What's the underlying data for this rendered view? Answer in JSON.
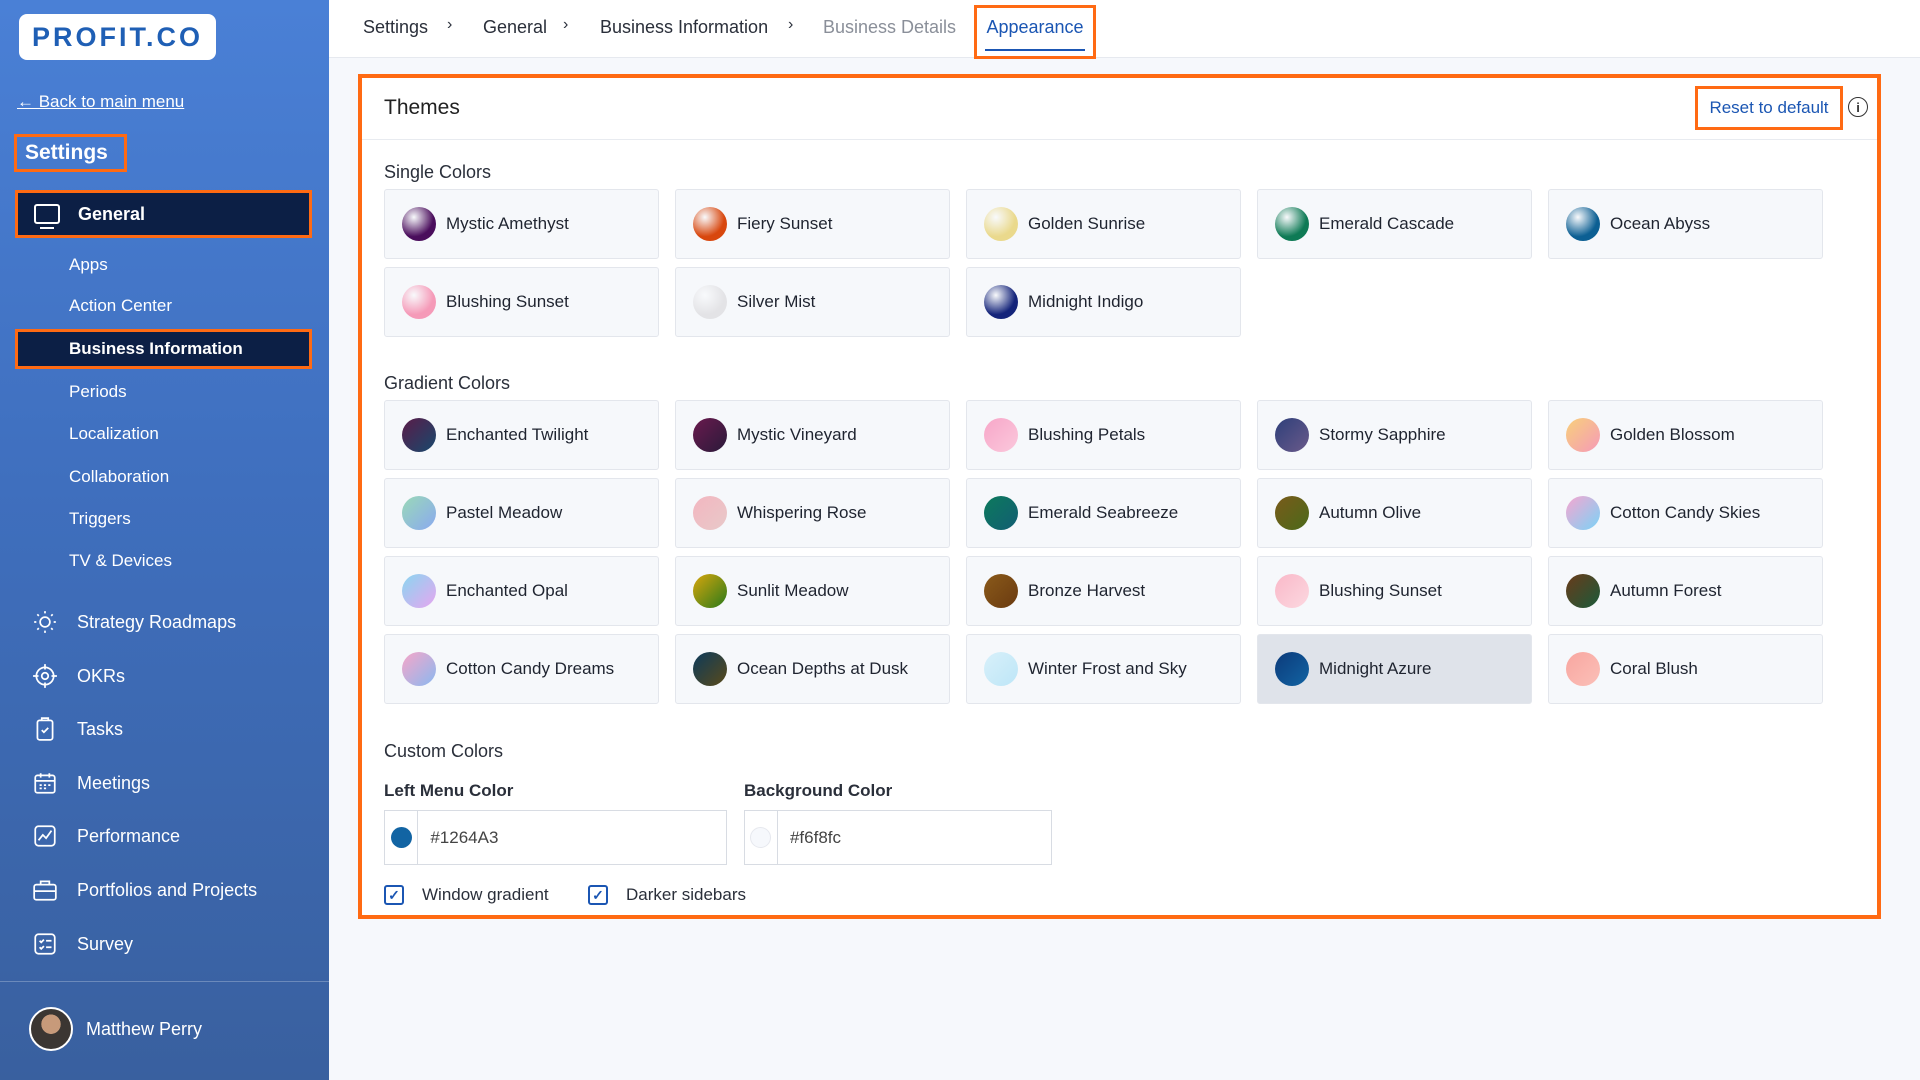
{
  "sidebar": {
    "logo": "PROFIT.CO",
    "back_link": "← Back to main menu",
    "title": "Settings",
    "general": {
      "label": "General",
      "icon": "monitor-icon"
    },
    "sub_items": [
      "Apps",
      "Action Center",
      "Business Information",
      "Periods",
      "Localization",
      "Collaboration",
      "Triggers",
      "TV & Devices"
    ],
    "active_sub_item": "Business Information",
    "main_items": [
      {
        "label": "Strategy Roadmaps",
        "icon": "lightbulb-icon"
      },
      {
        "label": "OKRs",
        "icon": "target-icon"
      },
      {
        "label": "Tasks",
        "icon": "clipboard-check-icon"
      },
      {
        "label": "Meetings",
        "icon": "calendar-icon"
      },
      {
        "label": "Performance",
        "icon": "chart-line-icon"
      },
      {
        "label": "Portfolios and Projects",
        "icon": "briefcase-icon"
      },
      {
        "label": "Survey",
        "icon": "list-check-icon"
      }
    ],
    "user": {
      "name": "Matthew Perry"
    }
  },
  "breadcrumb": {
    "items": [
      "Settings",
      "General",
      "Business Information"
    ],
    "muted": "Business Details",
    "active": "Appearance",
    "separator": "›"
  },
  "panel": {
    "title": "Themes",
    "reset_label": "Reset to default",
    "info_icon": "info-icon",
    "single_label": "Single Colors",
    "single_colors": [
      {
        "name": "Mystic Amethyst",
        "color": "#4a0d5c"
      },
      {
        "name": "Fiery Sunset",
        "color": "#d8470e"
      },
      {
        "name": "Golden Sunrise",
        "color": "#ead98c"
      },
      {
        "name": "Emerald Cascade",
        "color": "#0e7a55"
      },
      {
        "name": "Ocean Abyss",
        "color": "#0c5f93"
      },
      {
        "name": "Blushing Sunset",
        "color": "#f59ab8"
      },
      {
        "name": "Silver Mist",
        "color": "#e3e3e6"
      },
      {
        "name": "Midnight Indigo",
        "color": "#14247a"
      }
    ],
    "gradient_label": "Gradient Colors",
    "gradient_colors": [
      {
        "name": "Enchanted Twilight",
        "from": "#5b1b48",
        "to": "#17496d"
      },
      {
        "name": "Mystic Vineyard",
        "from": "#6a1a4e",
        "to": "#2a1a3a"
      },
      {
        "name": "Blushing Petals",
        "from": "#f7a6c8",
        "to": "#fbc8dc"
      },
      {
        "name": "Stormy Sapphire",
        "from": "#2e3f7a",
        "to": "#6a5a8a"
      },
      {
        "name": "Golden Blossom",
        "from": "#f8d07a",
        "to": "#f59ab8"
      },
      {
        "name": "Pastel Meadow",
        "from": "#9ad9b7",
        "to": "#8aa9f0"
      },
      {
        "name": "Whispering Rose",
        "from": "#f3b6c0",
        "to": "#e8c9c9"
      },
      {
        "name": "Emerald Seabreeze",
        "from": "#0c7a5c",
        "to": "#125d73"
      },
      {
        "name": "Autumn Olive",
        "from": "#7a5a1a",
        "to": "#4a6a1a"
      },
      {
        "name": "Cotton Candy Skies",
        "from": "#f7a6d0",
        "to": "#7ad3f7"
      },
      {
        "name": "Enchanted Opal",
        "from": "#8ad6f0",
        "to": "#e6a6f0"
      },
      {
        "name": "Sunlit Meadow",
        "from": "#d9a60c",
        "to": "#2a7a1a"
      },
      {
        "name": "Bronze Harvest",
        "from": "#8a5a1a",
        "to": "#6a3a10"
      },
      {
        "name": "Blushing Sunset",
        "from": "#f9b8c8",
        "to": "#fcd8e0"
      },
      {
        "name": "Autumn Forest",
        "from": "#6a3a1a",
        "to": "#1a5a3a"
      },
      {
        "name": "Cotton Candy Dreams",
        "from": "#f7a6c8",
        "to": "#8ab8f0"
      },
      {
        "name": "Ocean Depths at Dusk",
        "from": "#0c3a5a",
        "to": "#5a4a1a"
      },
      {
        "name": "Winter Frost and Sky",
        "from": "#d8f0fa",
        "to": "#bde6f7"
      },
      {
        "name": "Midnight Azure",
        "from": "#0c3a7a",
        "to": "#1264a3"
      },
      {
        "name": "Coral Blush",
        "from": "#f8a6a0",
        "to": "#fbc0b8"
      }
    ],
    "selected_theme": "Midnight Azure",
    "custom_label": "Custom Colors",
    "left_menu_label": "Left Menu Color",
    "left_menu_value": "#1264A3",
    "left_menu_color": "#1264a3",
    "background_label": "Background Color",
    "background_value": "#f6f8fc",
    "background_color": "#f6f8fc",
    "window_gradient_label": "Window gradient",
    "darker_sidebars_label": "Darker sidebars",
    "window_gradient_checked": true,
    "darker_sidebars_checked": true
  }
}
